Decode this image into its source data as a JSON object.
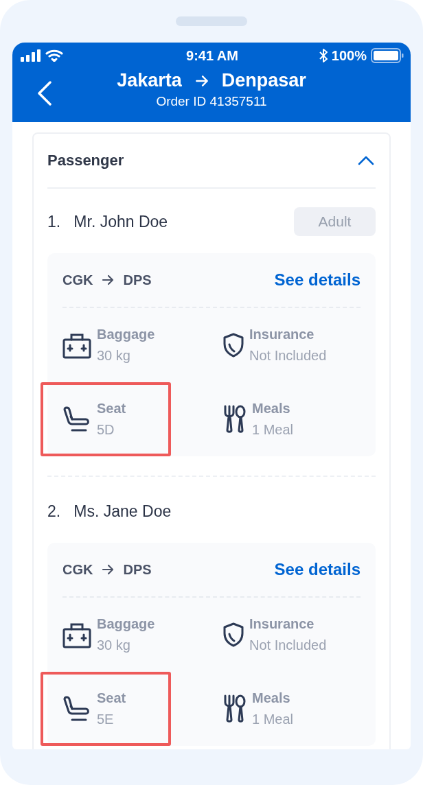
{
  "status_bar": {
    "time": "9:41 AM",
    "battery": "100%"
  },
  "header": {
    "from": "Jakarta",
    "to": "Denpasar",
    "subtitle": "Order ID 41357511"
  },
  "section": {
    "title": "Passenger",
    "expanded": true
  },
  "passengers": [
    {
      "number": "1.",
      "name": "Mr. John Doe",
      "badge": "Adult",
      "route": {
        "from": "CGK",
        "to": "DPS"
      },
      "link": "See details",
      "details": [
        {
          "kind": "baggage",
          "label": "Baggage",
          "value": "30 kg",
          "highlighted": false
        },
        {
          "kind": "insurance",
          "label": "Insurance",
          "value": "Not Included",
          "highlighted": false
        },
        {
          "kind": "seat",
          "label": "Seat",
          "value": "5D",
          "highlighted": true
        },
        {
          "kind": "meals",
          "label": "Meals",
          "value": "1 Meal",
          "highlighted": false
        }
      ]
    },
    {
      "number": "2.",
      "name": "Ms. Jane Doe",
      "route": {
        "from": "CGK",
        "to": "DPS"
      },
      "link": "See details",
      "details": [
        {
          "kind": "baggage",
          "label": "Baggage",
          "value": "30 kg",
          "highlighted": false
        },
        {
          "kind": "insurance",
          "label": "Insurance",
          "value": "Not Included",
          "highlighted": false
        },
        {
          "kind": "seat",
          "label": "Seat",
          "value": "5E",
          "highlighted": true
        },
        {
          "kind": "meals",
          "label": "Meals",
          "value": "1 Meal",
          "highlighted": false
        }
      ]
    }
  ]
}
